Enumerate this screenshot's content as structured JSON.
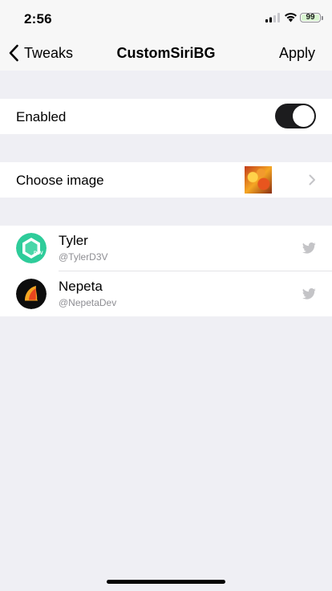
{
  "status_bar": {
    "time": "2:56",
    "battery_level": "99",
    "icons": [
      "signal-icon",
      "wifi-icon",
      "battery-icon"
    ]
  },
  "nav": {
    "back_label": "Tweaks",
    "title": "CustomSiriBG",
    "apply_label": "Apply"
  },
  "settings": {
    "enabled_label": "Enabled",
    "enabled_state": true,
    "choose_image_label": "Choose image"
  },
  "developers": [
    {
      "name": "Tyler",
      "handle": "@TylerD3V",
      "icon": "twitter-bird-icon"
    },
    {
      "name": "Nepeta",
      "handle": "@NepetaDev",
      "icon": "twitter-bird-icon"
    }
  ],
  "colors": {
    "background": "#efeff4",
    "toggle_on": "#1c1c1e",
    "tyler_avatar": "#2ecc9a",
    "nepeta_avatar": "#f5a623"
  }
}
